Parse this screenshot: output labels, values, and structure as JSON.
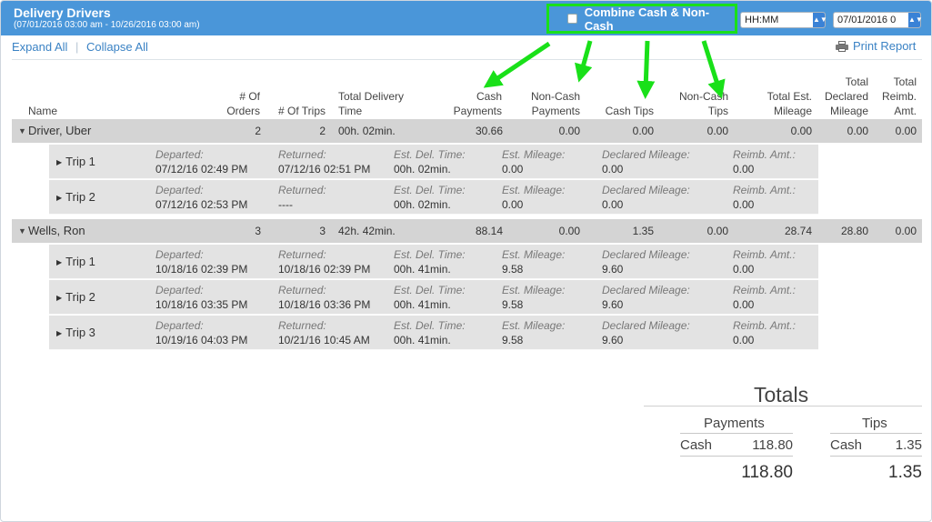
{
  "header": {
    "title": "Delivery Drivers",
    "subtitle": "(07/01/2016 03:00 am - 10/26/2016 03:00 am)",
    "combine_label": "Combine Cash & Non-Cash",
    "time_value": "HH:MM",
    "date_value": "07/01/2016 0",
    "highlight_color": "#19e019",
    "bar_color": "#4a96d9"
  },
  "toolbar": {
    "expand_all": "Expand All",
    "separator": "|",
    "collapse_all": "Collapse All",
    "print_report": "Print Report"
  },
  "columns": {
    "name": "Name",
    "orders_1": "# Of",
    "orders_2": "Orders",
    "trips": "# Of Trips",
    "delivery_1": "Total Delivery",
    "delivery_2": "Time",
    "cash_pay_1": "Cash",
    "cash_pay_2": "Payments",
    "noncash_pay_1": "Non-Cash",
    "noncash_pay_2": "Payments",
    "cash_tips": "Cash Tips",
    "noncash_tips_1": "Non-Cash",
    "noncash_tips_2": "Tips",
    "est_mileage_1": "Total Est.",
    "est_mileage_2": "Mileage",
    "declared_1": "Total",
    "declared_2": "Declared",
    "declared_3": "Mileage",
    "reimb_1": "Total",
    "reimb_2": "Reimb.",
    "reimb_3": "Amt."
  },
  "trip_labels": {
    "departed": "Departed:",
    "returned": "Returned:",
    "est_del_time": "Est. Del. Time:",
    "est_mileage": "Est. Mileage:",
    "declared_mileage": "Declared Mileage:",
    "reimb_amt": "Reimb. Amt.:"
  },
  "drivers": [
    {
      "name": "Driver, Uber",
      "orders": "2",
      "trips": "2",
      "delivery_time": "00h. 02min.",
      "cash_payments": "30.66",
      "noncash_payments": "0.00",
      "cash_tips": "0.00",
      "noncash_tips": "0.00",
      "est_mileage": "0.00",
      "declared_mileage": "0.00",
      "reimb_amt": "0.00",
      "trip_rows": [
        {
          "label": "Trip 1",
          "departed": "07/12/16 02:49 PM",
          "returned": "07/12/16 02:51 PM",
          "est_del_time": "00h. 02min.",
          "est_mileage": "0.00",
          "declared_mileage": "0.00",
          "reimb_amt": "0.00"
        },
        {
          "label": "Trip 2",
          "departed": "07/12/16 02:53 PM",
          "returned": "----",
          "est_del_time": "00h. 02min.",
          "est_mileage": "0.00",
          "declared_mileage": "0.00",
          "reimb_amt": "0.00"
        }
      ]
    },
    {
      "name": "Wells, Ron",
      "orders": "3",
      "trips": "3",
      "delivery_time": "42h. 42min.",
      "cash_payments": "88.14",
      "noncash_payments": "0.00",
      "cash_tips": "1.35",
      "noncash_tips": "0.00",
      "est_mileage": "28.74",
      "declared_mileage": "28.80",
      "reimb_amt": "0.00",
      "trip_rows": [
        {
          "label": "Trip 1",
          "departed": "10/18/16 02:39 PM",
          "returned": "10/18/16 02:39 PM",
          "est_del_time": "00h. 41min.",
          "est_mileage": "9.58",
          "declared_mileage": "9.60",
          "reimb_amt": "0.00"
        },
        {
          "label": "Trip 2",
          "departed": "10/18/16 03:35 PM",
          "returned": "10/18/16 03:36 PM",
          "est_del_time": "00h. 41min.",
          "est_mileage": "9.58",
          "declared_mileage": "9.60",
          "reimb_amt": "0.00"
        },
        {
          "label": "Trip 3",
          "departed": "10/19/16 04:03 PM",
          "returned": "10/21/16 10:45 AM",
          "est_del_time": "00h. 41min.",
          "est_mileage": "9.58",
          "declared_mileage": "9.60",
          "reimb_amt": "0.00"
        }
      ]
    }
  ],
  "totals": {
    "title": "Totals",
    "payments_header": "Payments",
    "tips_header": "Tips",
    "payments_cash_label": "Cash",
    "payments_cash_value": "118.80",
    "payments_total": "118.80",
    "tips_cash_label": "Cash",
    "tips_cash_value": "1.35",
    "tips_total": "1.35"
  },
  "annotation": {
    "arrow_color": "#19e019"
  }
}
